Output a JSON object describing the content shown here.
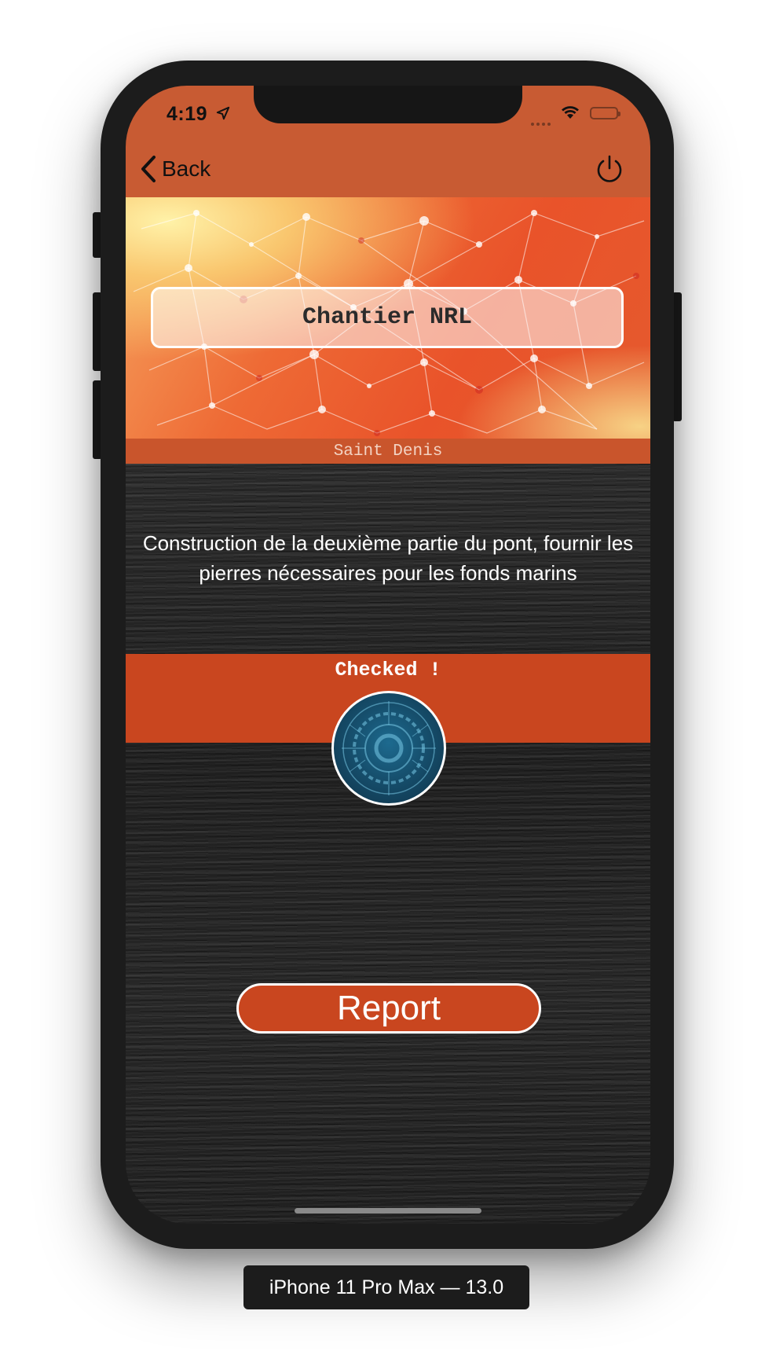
{
  "status_bar": {
    "time": "4:19",
    "icons": [
      "location-arrow-icon",
      "signal-dots-icon",
      "wifi-icon",
      "battery-icon"
    ]
  },
  "nav": {
    "back_label": "Back",
    "back_icon": "chevron-left-icon",
    "power_icon": "power-icon"
  },
  "banner": {
    "title": "Chantier NRL",
    "location": "Saint Denis"
  },
  "main": {
    "description": "Construction de la deuxième partie du pont, fournir les pierres nécessaires pour les fonds marins",
    "status_label": "Checked !",
    "badge_icon": "tech-circle-icon",
    "report_label": "Report"
  },
  "device": {
    "label": "iPhone 11 Pro Max — 13.0"
  },
  "colors": {
    "nav_bar": "#c85b33",
    "accent": "#c9461f",
    "background": "#1f1f1f"
  }
}
